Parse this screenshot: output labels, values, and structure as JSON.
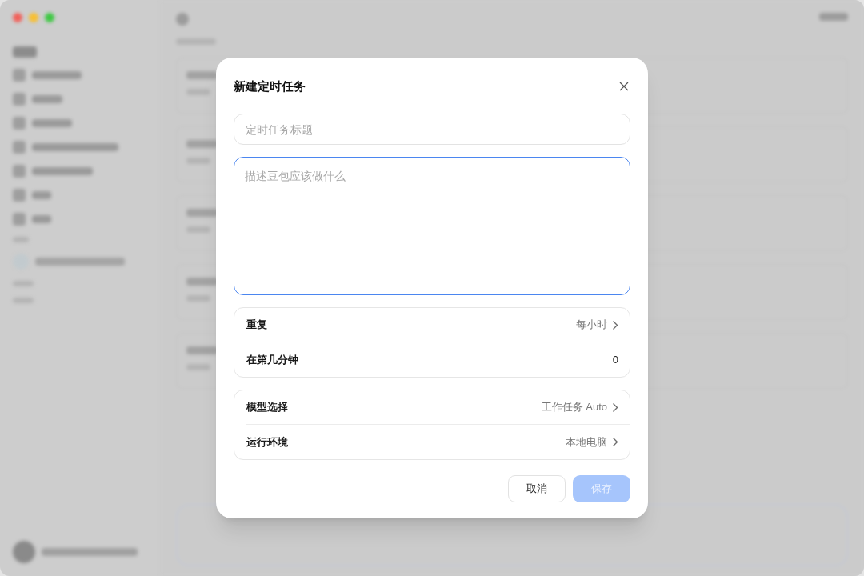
{
  "dialog": {
    "title": "新建定时任务",
    "title_field": {
      "placeholder": "定时任务标题"
    },
    "description_field": {
      "placeholder": "描述豆包应该做什么",
      "focused": true
    },
    "groups": [
      {
        "rows": [
          {
            "kind": "select",
            "label": "重复",
            "value": "每小时"
          },
          {
            "kind": "number",
            "label": "在第几分钟",
            "value": "0"
          }
        ]
      },
      {
        "rows": [
          {
            "kind": "select",
            "label": "模型选择",
            "value": "工作任务 Auto"
          },
          {
            "kind": "select",
            "label": "运行环境",
            "value": "本地电脑"
          }
        ]
      }
    ],
    "buttons": [
      {
        "kind": "secondary",
        "label": "取消",
        "disabled": false
      },
      {
        "kind": "primary",
        "label": "保存",
        "disabled": true
      }
    ]
  }
}
